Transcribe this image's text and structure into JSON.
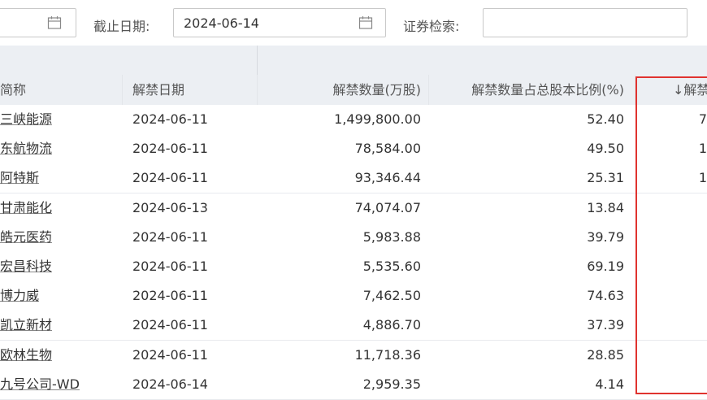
{
  "filters": {
    "start_date_value": "",
    "end_date_label": "截止日期:",
    "end_date_value": "2024-06-14",
    "search_label": "证券检索:",
    "search_value": ""
  },
  "table": {
    "headers": {
      "name": "简称",
      "date": "解禁日期",
      "quantity": "解禁数量(万股)",
      "ratio": "解禁数量占总股本比例(%)",
      "sorted": "↓解禁"
    },
    "rows": [
      {
        "name": "三峡能源",
        "date": "2024-06-11",
        "quantity": "1,499,800.00",
        "ratio": "52.40",
        "extra": "7"
      },
      {
        "name": "东航物流",
        "date": "2024-06-11",
        "quantity": "78,584.00",
        "ratio": "49.50",
        "extra": "1"
      },
      {
        "name": "阿特斯",
        "date": "2024-06-11",
        "quantity": "93,346.44",
        "ratio": "25.31",
        "extra": "1"
      },
      {
        "name": "甘肃能化",
        "date": "2024-06-13",
        "quantity": "74,074.07",
        "ratio": "13.84",
        "extra": ""
      },
      {
        "name": "皓元医药",
        "date": "2024-06-11",
        "quantity": "5,983.88",
        "ratio": "39.79",
        "extra": ""
      },
      {
        "name": "宏昌科技",
        "date": "2024-06-11",
        "quantity": "5,535.60",
        "ratio": "69.19",
        "extra": ""
      },
      {
        "name": "博力威",
        "date": "2024-06-11",
        "quantity": "7,462.50",
        "ratio": "74.63",
        "extra": ""
      },
      {
        "name": "凯立新材",
        "date": "2024-06-11",
        "quantity": "4,886.70",
        "ratio": "37.39",
        "extra": ""
      },
      {
        "name": "欧林生物",
        "date": "2024-06-11",
        "quantity": "11,718.36",
        "ratio": "28.85",
        "extra": ""
      },
      {
        "name": "九号公司-WD",
        "date": "2024-06-14",
        "quantity": "2,959.35",
        "ratio": "4.14",
        "extra": ""
      }
    ]
  },
  "colors": {
    "highlight_border": "#e0332f",
    "header_bg": "#eceff3"
  },
  "icons": {
    "calendar": "calendar-icon"
  }
}
